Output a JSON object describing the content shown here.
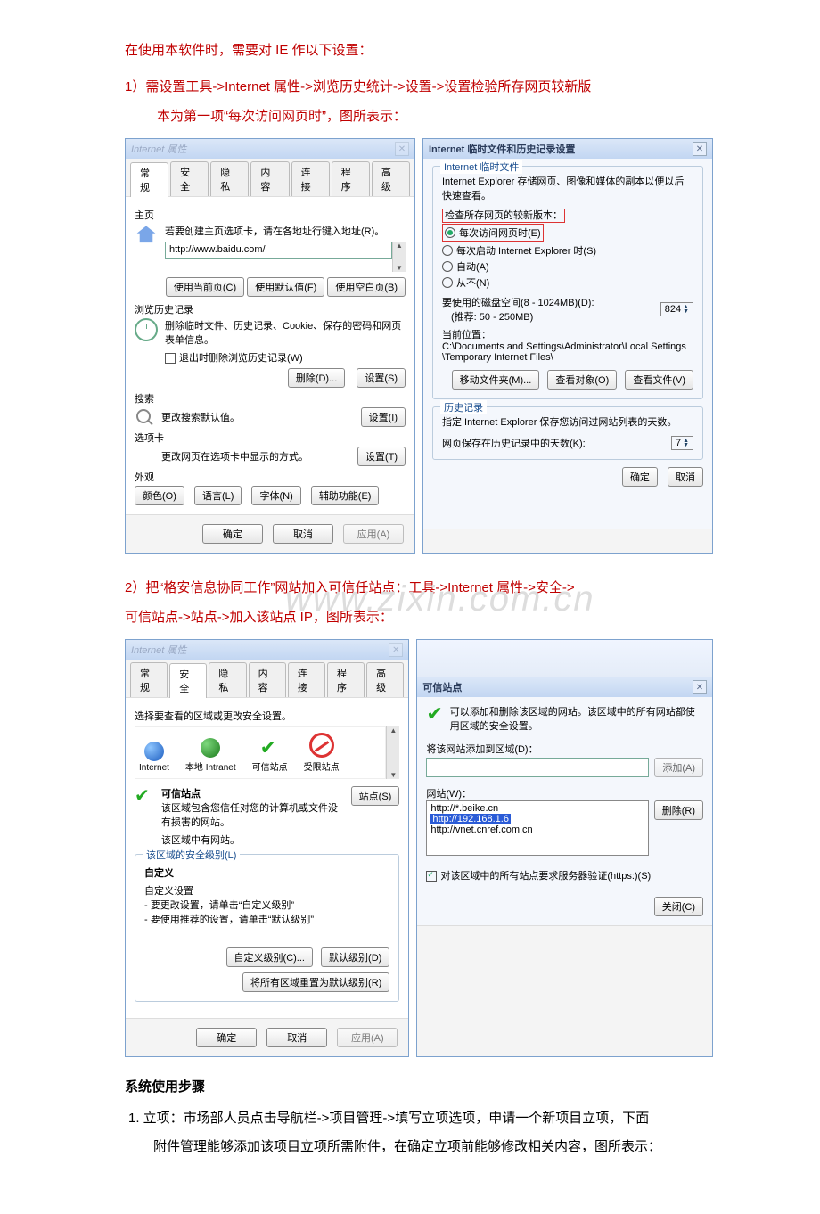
{
  "intro": {
    "line1": "在使用本软件时，需要对 IE 作以下设置：",
    "line2a": "1）需设置工具->Internet 属性->浏览历史统计->设置->设置检验所存网页较新版",
    "line2b": "本为第一项“每次访问网页时”，图所表示："
  },
  "watermark": "www.zixin.com.cn",
  "dlg1": {
    "title": "Internet 属性",
    "tabs": [
      "常规",
      "安全",
      "隐私",
      "内容",
      "连接",
      "程序",
      "高级"
    ],
    "home_label": "主页",
    "home_hint": "若要创建主页选项卡，请在各地址行键入地址(R)。",
    "home_url": "http://www.baidu.com/",
    "home_btns": [
      "使用当前页(C)",
      "使用默认值(F)",
      "使用空白页(B)"
    ],
    "history_label": "浏览历史记录",
    "history_desc": "删除临时文件、历史记录、Cookie、保存的密码和网页表单信息。",
    "history_chk": "退出时删除浏览历史记录(W)",
    "history_btns": [
      "删除(D)...",
      "设置(S)"
    ],
    "search_label": "搜索",
    "search_desc": "更改搜索默认值。",
    "search_btn": "设置(I)",
    "tabs_label": "选项卡",
    "tabs_desc": "更改网页在选项卡中显示的方式。",
    "tabs_btn": "设置(T)",
    "appearance_label": "外观",
    "appearance_btns": [
      "颜色(O)",
      "语言(L)",
      "字体(N)",
      "辅助功能(E)"
    ],
    "footer": [
      "确定",
      "取消",
      "应用(A)"
    ]
  },
  "dlg2": {
    "title": "Internet 临时文件和历史记录设置",
    "fs_label": "Internet 临时文件",
    "desc1": "Internet Explorer 存储网页、图像和媒体的副本以便以后快速查看。",
    "check_label": "检查所存网页的较新版本：",
    "opts": [
      "每次访问网页时(E)",
      "每次启动 Internet Explorer 时(S)",
      "自动(A)",
      "从不(N)"
    ],
    "disk_label": "要使用的磁盘空间(8 - 1024MB)(D):",
    "disk_hint": "(推荐: 50 - 250MB)",
    "disk_val": "824",
    "loc_label": "当前位置：",
    "loc_val": "C:\\Documents and Settings\\Administrator\\Local Settings\\Temporary Internet Files\\",
    "loc_btns": [
      "移动文件夹(M)...",
      "查看对象(O)",
      "查看文件(V)"
    ],
    "hist_fs": "历史记录",
    "hist_desc": "指定 Internet Explorer 保存您访问过网站列表的天数。",
    "hist_days_label": "网页保存在历史记录中的天数(K):",
    "hist_days_val": "7",
    "footer": [
      "确定",
      "取消"
    ]
  },
  "mid": {
    "line1": "2）把“格安信息协同工作”网站加入可信任站点：工具->Internet 属性->安全->",
    "line2": "可信站点->站点->加入该站点 IP，图所表示："
  },
  "dlg3": {
    "title": "Internet 属性",
    "tabs": [
      "常规",
      "安全",
      "隐私",
      "内容",
      "连接",
      "程序",
      "高级"
    ],
    "select_hint": "选择要查看的区域或更改安全设置。",
    "zones": [
      "Internet",
      "本地 Intranet",
      "可信站点",
      "受限站点"
    ],
    "trusted_label": "可信站点",
    "trusted_desc1": "该区域包含您信任对您的计算机或文件没有损害的网站。",
    "trusted_desc2": "该区域中有网站。",
    "sites_btn": "站点(S)",
    "seclevel_label": "该区域的安全级别(L)",
    "custom_label": "自定义",
    "custom_l1": "自定义设置",
    "custom_l2": "- 要更改设置，请单击“自定义级别”",
    "custom_l3": "- 要使用推荐的设置，请单击“默认级别”",
    "btns": [
      "自定义级别(C)...",
      "默认级别(D)"
    ],
    "reset_btn": "将所有区域重置为默认级别(R)",
    "footer": [
      "确定",
      "取消",
      "应用(A)"
    ]
  },
  "dlg4": {
    "title": "可信站点",
    "desc": "可以添加和删除该区域的网站。该区域中的所有网站都使用区域的安全设置。",
    "add_label": "将该网站添加到区域(D)：",
    "add_btn": "添加(A)",
    "sites_label": "网站(W)：",
    "sites": [
      "http://*.beike.cn",
      "http://192.168.1.6",
      "http://vnet.cnref.com.cn"
    ],
    "del_btn": "删除(R)",
    "https_chk": "对该区域中的所有站点要求服务器验证(https:)(S)",
    "close_btn": "关闭(C)"
  },
  "footer_section": {
    "heading": "系统使用步骤",
    "step1a": "1.  立项：市场部人员点击导航栏->项目管理->填写立项选项，申请一个新项目立项，下面",
    "step1b": "附件管理能够添加该项目立项所需附件，在确定立项前能够修改相关内容，图所表示："
  }
}
